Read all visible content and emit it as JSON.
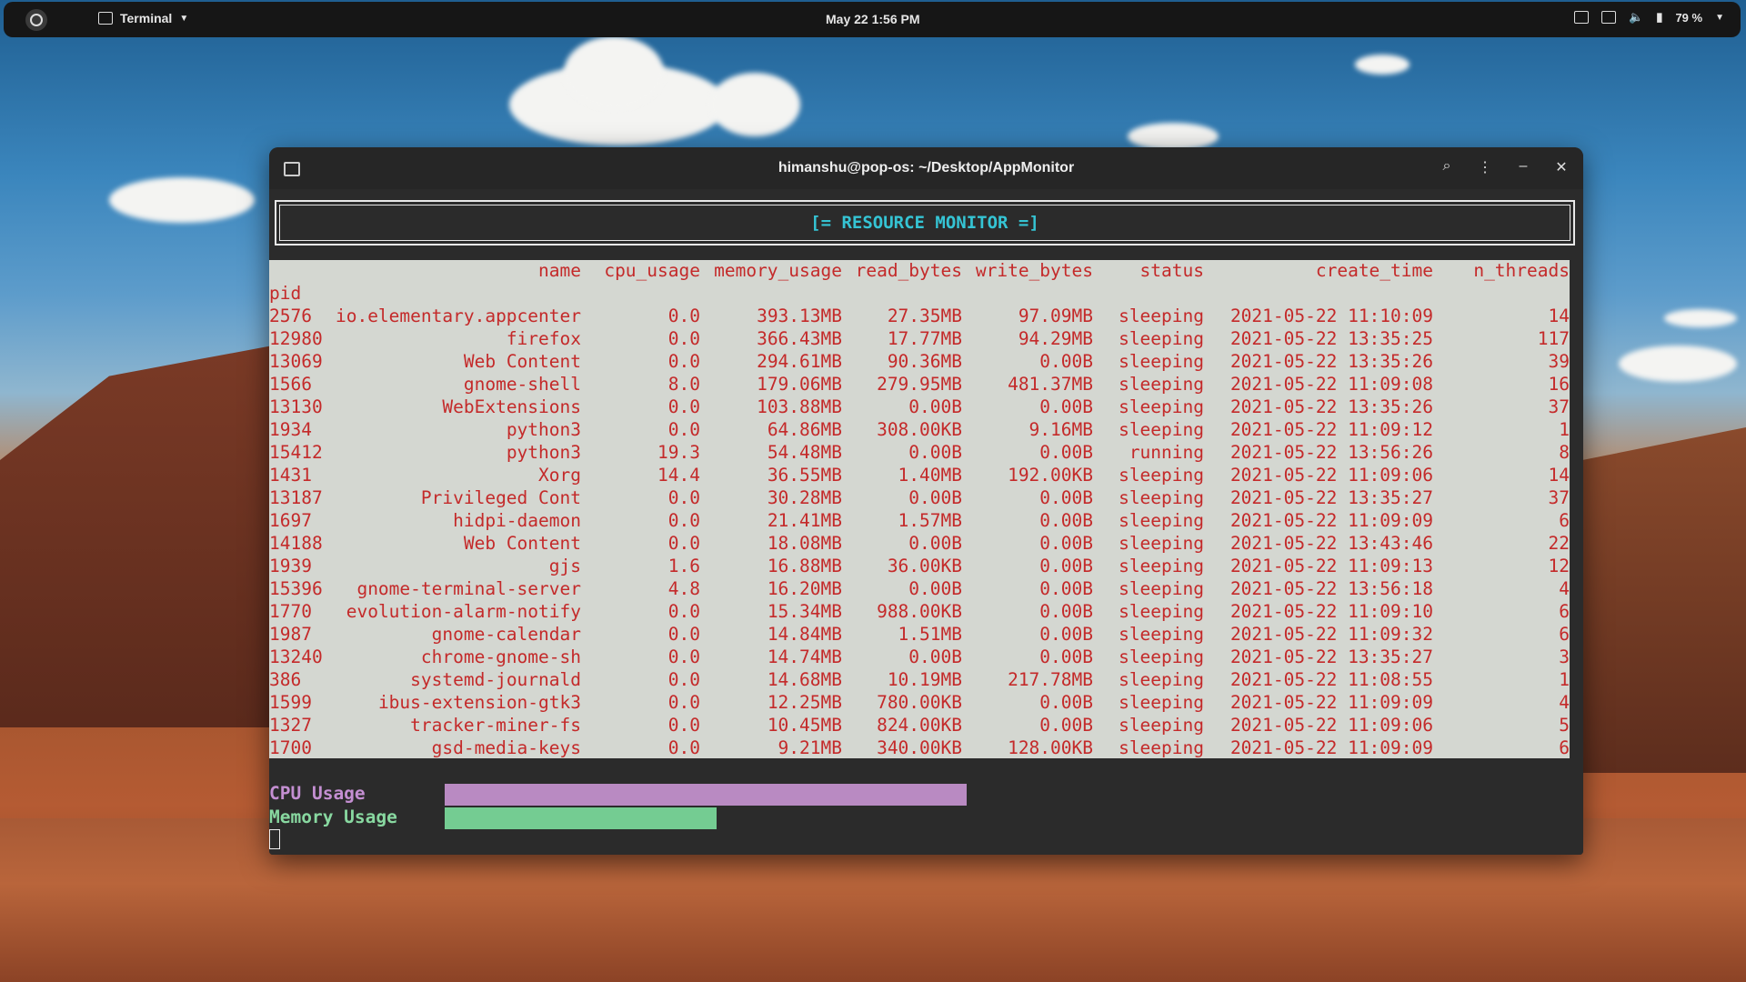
{
  "topbar": {
    "app_name": "Terminal",
    "clock": "May 22  1:56 PM",
    "battery": "79 %"
  },
  "window": {
    "title": "himanshu@pop-os: ~/Desktop/AppMonitor"
  },
  "monitor": {
    "header": "[= RESOURCE MONITOR =]",
    "columns": {
      "name": "name",
      "cpu_usage": "cpu_usage",
      "memory_usage": "memory_usage",
      "read_bytes": "read_bytes",
      "write_bytes": "write_bytes",
      "status": "status",
      "create_time": "create_time",
      "n_threads": "n_threads",
      "index": "pid"
    },
    "rows": [
      {
        "pid": "2576",
        "name": "io.elementary.appcenter",
        "cpu": "0.0",
        "mem": "393.13MB",
        "rd": "27.35MB",
        "wr": "97.09MB",
        "st": "sleeping",
        "ct": "2021-05-22 11:10:09",
        "th": "14"
      },
      {
        "pid": "12980",
        "name": "firefox",
        "cpu": "0.0",
        "mem": "366.43MB",
        "rd": "17.77MB",
        "wr": "94.29MB",
        "st": "sleeping",
        "ct": "2021-05-22 13:35:25",
        "th": "117"
      },
      {
        "pid": "13069",
        "name": "Web Content",
        "cpu": "0.0",
        "mem": "294.61MB",
        "rd": "90.36MB",
        "wr": "0.00B",
        "st": "sleeping",
        "ct": "2021-05-22 13:35:26",
        "th": "39"
      },
      {
        "pid": "1566",
        "name": "gnome-shell",
        "cpu": "8.0",
        "mem": "179.06MB",
        "rd": "279.95MB",
        "wr": "481.37MB",
        "st": "sleeping",
        "ct": "2021-05-22 11:09:08",
        "th": "16"
      },
      {
        "pid": "13130",
        "name": "WebExtensions",
        "cpu": "0.0",
        "mem": "103.88MB",
        "rd": "0.00B",
        "wr": "0.00B",
        "st": "sleeping",
        "ct": "2021-05-22 13:35:26",
        "th": "37"
      },
      {
        "pid": "1934",
        "name": "python3",
        "cpu": "0.0",
        "mem": "64.86MB",
        "rd": "308.00KB",
        "wr": "9.16MB",
        "st": "sleeping",
        "ct": "2021-05-22 11:09:12",
        "th": "1"
      },
      {
        "pid": "15412",
        "name": "python3",
        "cpu": "19.3",
        "mem": "54.48MB",
        "rd": "0.00B",
        "wr": "0.00B",
        "st": "running",
        "ct": "2021-05-22 13:56:26",
        "th": "8"
      },
      {
        "pid": "1431",
        "name": "Xorg",
        "cpu": "14.4",
        "mem": "36.55MB",
        "rd": "1.40MB",
        "wr": "192.00KB",
        "st": "sleeping",
        "ct": "2021-05-22 11:09:06",
        "th": "14"
      },
      {
        "pid": "13187",
        "name": "Privileged Cont",
        "cpu": "0.0",
        "mem": "30.28MB",
        "rd": "0.00B",
        "wr": "0.00B",
        "st": "sleeping",
        "ct": "2021-05-22 13:35:27",
        "th": "37"
      },
      {
        "pid": "1697",
        "name": "hidpi-daemon",
        "cpu": "0.0",
        "mem": "21.41MB",
        "rd": "1.57MB",
        "wr": "0.00B",
        "st": "sleeping",
        "ct": "2021-05-22 11:09:09",
        "th": "6"
      },
      {
        "pid": "14188",
        "name": "Web Content",
        "cpu": "0.0",
        "mem": "18.08MB",
        "rd": "0.00B",
        "wr": "0.00B",
        "st": "sleeping",
        "ct": "2021-05-22 13:43:46",
        "th": "22"
      },
      {
        "pid": "1939",
        "name": "gjs",
        "cpu": "1.6",
        "mem": "16.88MB",
        "rd": "36.00KB",
        "wr": "0.00B",
        "st": "sleeping",
        "ct": "2021-05-22 11:09:13",
        "th": "12"
      },
      {
        "pid": "15396",
        "name": "gnome-terminal-server",
        "cpu": "4.8",
        "mem": "16.20MB",
        "rd": "0.00B",
        "wr": "0.00B",
        "st": "sleeping",
        "ct": "2021-05-22 13:56:18",
        "th": "4"
      },
      {
        "pid": "1770",
        "name": "evolution-alarm-notify",
        "cpu": "0.0",
        "mem": "15.34MB",
        "rd": "988.00KB",
        "wr": "0.00B",
        "st": "sleeping",
        "ct": "2021-05-22 11:09:10",
        "th": "6"
      },
      {
        "pid": "1987",
        "name": "gnome-calendar",
        "cpu": "0.0",
        "mem": "14.84MB",
        "rd": "1.51MB",
        "wr": "0.00B",
        "st": "sleeping",
        "ct": "2021-05-22 11:09:32",
        "th": "6"
      },
      {
        "pid": "13240",
        "name": "chrome-gnome-sh",
        "cpu": "0.0",
        "mem": "14.74MB",
        "rd": "0.00B",
        "wr": "0.00B",
        "st": "sleeping",
        "ct": "2021-05-22 13:35:27",
        "th": "3"
      },
      {
        "pid": "386",
        "name": "systemd-journald",
        "cpu": "0.0",
        "mem": "14.68MB",
        "rd": "10.19MB",
        "wr": "217.78MB",
        "st": "sleeping",
        "ct": "2021-05-22 11:08:55",
        "th": "1"
      },
      {
        "pid": "1599",
        "name": "ibus-extension-gtk3",
        "cpu": "0.0",
        "mem": "12.25MB",
        "rd": "780.00KB",
        "wr": "0.00B",
        "st": "sleeping",
        "ct": "2021-05-22 11:09:09",
        "th": "4"
      },
      {
        "pid": "1327",
        "name": "tracker-miner-fs",
        "cpu": "0.0",
        "mem": "10.45MB",
        "rd": "824.00KB",
        "wr": "0.00B",
        "st": "sleeping",
        "ct": "2021-05-22 11:09:06",
        "th": "5"
      },
      {
        "pid": "1700",
        "name": "gsd-media-keys",
        "cpu": "0.0",
        "mem": "9.21MB",
        "rd": "340.00KB",
        "wr": "128.00KB",
        "st": "sleeping",
        "ct": "2021-05-22 11:09:09",
        "th": "6"
      }
    ],
    "cpu_label": "CPU Usage",
    "memory_label": "Memory Usage",
    "cpu_bar_fraction": 0.4,
    "memory_bar_fraction": 0.21,
    "colors": {
      "cpu_bar": "#b98ac2",
      "memory_bar": "#74cc92",
      "table_text": "#c42a2a",
      "header_text": "#35c4d4"
    }
  }
}
